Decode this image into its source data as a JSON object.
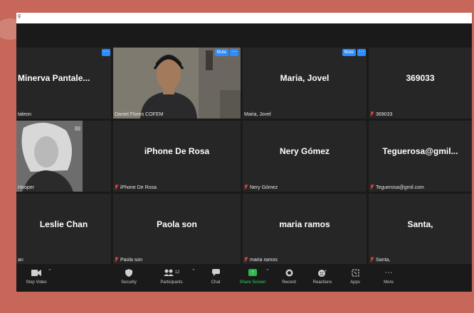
{
  "window": {
    "title_glyph": "g"
  },
  "tiles": [
    {
      "name": "Minerva  Pantale...",
      "label": "taleon",
      "muted": false
    },
    {
      "name": "",
      "label": "Daniel Flores COFEM",
      "muted": false,
      "video": true
    },
    {
      "name": "Maria, Jovel",
      "label": "Maria, Jovel",
      "muted": false
    },
    {
      "name": "369033",
      "label": "369033",
      "muted": true
    },
    {
      "name": "",
      "label": "Hooper",
      "muted": false,
      "video": true
    },
    {
      "name": "iPhone De Rosa",
      "label": "iPhone De Rosa",
      "muted": true
    },
    {
      "name": "Nery Gómez",
      "label": "Nery Gómez",
      "muted": true
    },
    {
      "name": "Teguerosa@gmil...",
      "label": "Teguerosa@gmil.com",
      "muted": true
    },
    {
      "name": "Leslie Chan",
      "label": "an",
      "muted": false
    },
    {
      "name": "Paola son",
      "label": "Paola son",
      "muted": true
    },
    {
      "name": "maria ramos",
      "label": "maria ramos",
      "muted": true
    },
    {
      "name": "Santa,",
      "label": "Santa,",
      "muted": true
    }
  ],
  "tile_controls": {
    "menu_label": "···",
    "mute_label": "Mute"
  },
  "toolbar": {
    "stop_video": "Stop Video",
    "security": "Security",
    "participants": "Participants",
    "participants_count": "12",
    "chat": "Chat",
    "share_screen": "Share Screen",
    "record": "Record",
    "reactions": "Reactions",
    "apps": "Apps",
    "more": "More"
  },
  "colors": {
    "accent": "#2d8cff",
    "active_speaker": "#d7e25a",
    "share": "#2fb84f",
    "background": "#c7675a"
  }
}
